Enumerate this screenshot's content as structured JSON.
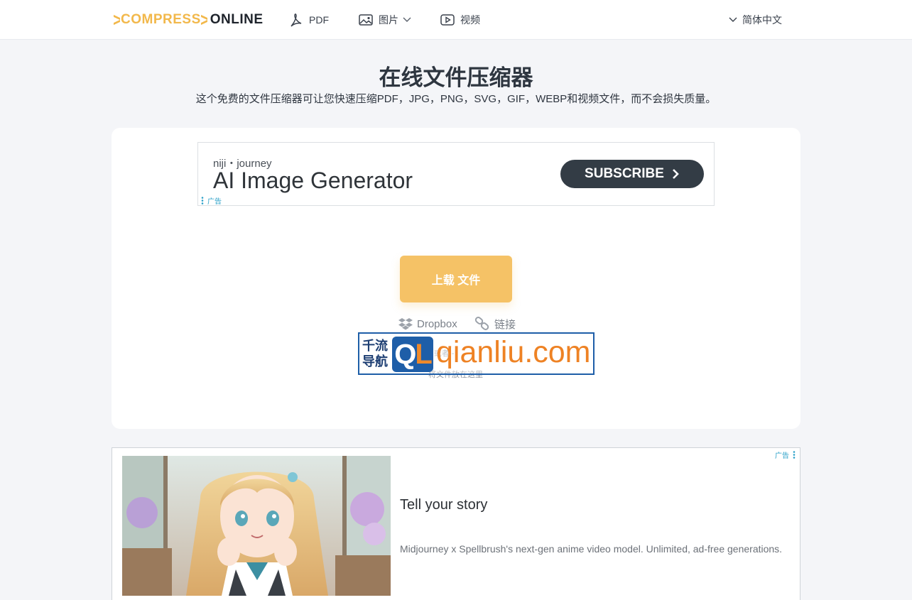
{
  "header": {
    "logo_left": "COMPRESS",
    "logo_right": "ONLINE",
    "nav": {
      "pdf": "PDF",
      "images": "图片",
      "video": "视频",
      "language": "简体中文"
    }
  },
  "main": {
    "title": "在线文件压缩器",
    "subtitle": "这个免费的文件压缩器可让您快速压缩PDF，JPG，PNG，SVG，GIF，WEBP和视频文件，而不会损失质量。",
    "upload_label": "上载 文件",
    "sources": {
      "dropbox": "Dropbox",
      "link": "链接"
    },
    "drop_separator": "- 或者 -",
    "drop_hint": "将文件放在这里"
  },
  "ad_top": {
    "brand": "niji・journey",
    "headline": "AI Image Generator",
    "cta": "SUBSCRIBE",
    "label": "广告"
  },
  "watermark": {
    "cn_line1": "千流",
    "cn_line2": "导航",
    "badge_q": "Q",
    "badge_l": "L",
    "url": "qianliu.com"
  },
  "ad_bottom": {
    "label": "广告",
    "title": "Tell your story",
    "description": "Midjourney x Spellbrush's next-gen anime video model. Unlimited, ad-free generations."
  },
  "colors": {
    "accent": "#f5c266",
    "logo_accent": "#f2b84b",
    "ad_label": "#2aa0c8",
    "cta_dark": "#333c45"
  }
}
